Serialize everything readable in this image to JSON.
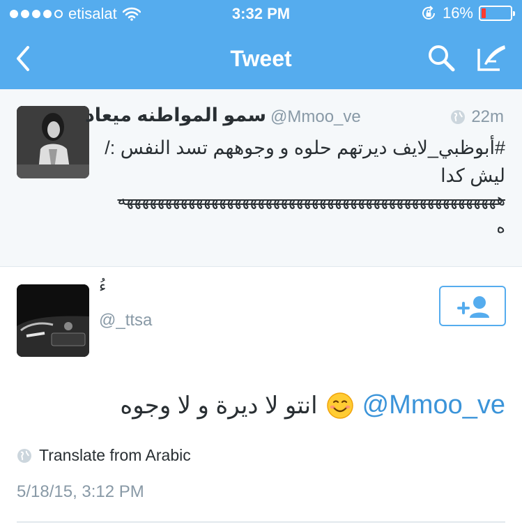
{
  "status_bar": {
    "carrier": "etisalat",
    "time": "3:32 PM",
    "battery": "16%",
    "battery_level": 0.16,
    "signal_bars": 4,
    "signal_total": 5
  },
  "nav": {
    "title": "Tweet",
    "back_icon": "chevron-left-icon",
    "search_icon": "search-icon",
    "compose_icon": "compose-icon"
  },
  "parent_tweet": {
    "display_name": "سمو المواطنه ميعاد",
    "handle": "@Mmoo_ve",
    "time": "22m",
    "text": "#أبوظبي_لايف ديرتهم حلوه و وجوههم تسد النفس :/ ليش كدا",
    "laugh": "هههههههههههههههههههههههههههههههههههههههههههههههههه",
    "tail": "ه"
  },
  "main_tweet": {
    "display_name": "ءُ",
    "handle": "@_ttsa",
    "mention": "@Mmoo_ve",
    "text": "انتو لا ديرة و لا وجوه",
    "emoji": "smiling-face-emoji",
    "translate_label": "Translate from Arabic",
    "date": "5/18/15, 3:12 PM"
  },
  "colors": {
    "header": "#55acee",
    "link": "#3b94d9",
    "muted": "#8899a6",
    "text": "#292f33",
    "battery_low": "#ff3b30"
  }
}
